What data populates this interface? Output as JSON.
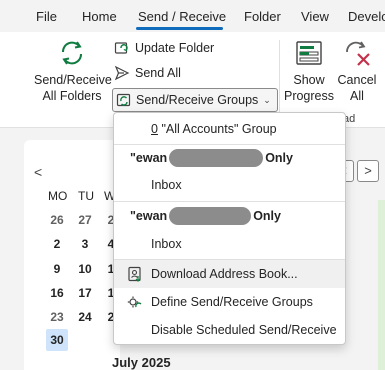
{
  "ribbon_tabs": [
    {
      "label": "File"
    },
    {
      "label": "Home"
    },
    {
      "label": "Send / Receive",
      "active": true
    },
    {
      "label": "Folder"
    },
    {
      "label": "View"
    },
    {
      "label": "Develo"
    }
  ],
  "ribbon": {
    "send_receive_all": {
      "line1": "Send/Receive",
      "line2": "All Folders"
    },
    "update_folder": "Update Folder",
    "send_all": "Send All",
    "send_receive_groups": "Send/Receive Groups",
    "show_progress": {
      "line1": "Show",
      "line2": "Progress"
    },
    "cancel_all": {
      "line1": "Cancel",
      "line2": "All"
    },
    "group_label_fragment": "ad"
  },
  "menu": {
    "all_accounts_prefix": "0",
    "all_accounts_label": "\"All Accounts\" Group",
    "account1": {
      "prefix": "\"ewan",
      "suffix": "Only"
    },
    "account1_inbox": "Inbox",
    "account2": {
      "prefix": "\"ewan",
      "suffix": "Only"
    },
    "account2_inbox": "Inbox",
    "download_address_book": "Download Address Book...",
    "define_groups": "Define Send/Receive Groups",
    "disable_scheduled": "Disable Scheduled Send/Receive"
  },
  "calendar": {
    "nav_prev": "<",
    "days_of_week": [
      "MO",
      "TU",
      "W"
    ],
    "rows": [
      [
        "26",
        "27",
        "2"
      ],
      [
        "2",
        "3",
        "4"
      ],
      [
        "9",
        "10",
        "1"
      ],
      [
        "16",
        "17",
        "1"
      ],
      [
        "23",
        "24",
        "2"
      ],
      [
        "30"
      ]
    ],
    "today": "30",
    "next_month": "July 2025"
  },
  "right": {
    "nav_prev": "<",
    "nav_next": ">"
  },
  "colors": {
    "accent": "#0f6cbd",
    "green_icon": "#107c41",
    "red_icon": "#c4314b",
    "today_bg": "#cfe4fa"
  }
}
